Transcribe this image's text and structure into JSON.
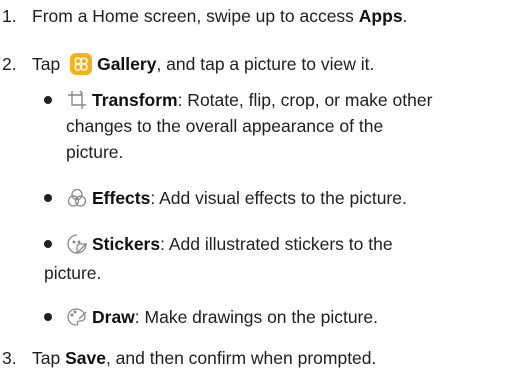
{
  "steps": [
    {
      "num": "1.",
      "pre": "From a Home screen, swipe up to access ",
      "bold": "Apps",
      "post": "."
    },
    {
      "num": "2.",
      "pre": "Tap ",
      "bold": "Gallery",
      "post": ", and tap a picture to view it.",
      "icon": "gallery-icon"
    },
    {
      "num": "3.",
      "pre": "Tap ",
      "bold": "Save",
      "post": ", and then confirm when prompted."
    }
  ],
  "bullets": [
    {
      "icon": "transform-icon",
      "bold": "Transform",
      "line1": ": Rotate, flip, crop, or make other",
      "line2": "changes to the overall appearance of the",
      "line3": "picture."
    },
    {
      "icon": "effects-icon",
      "bold": "Effects",
      "line1": ": Add visual effects to the picture."
    },
    {
      "icon": "stickers-icon",
      "bold": "Stickers",
      "line1": ": Add illustrated stickers to the",
      "line2": "picture."
    },
    {
      "icon": "draw-icon",
      "bold": "Draw",
      "line1": ": Make drawings on the picture."
    }
  ],
  "colors": {
    "text": "#202020",
    "gallery_icon": "#f5b31b",
    "icon_stroke": "#888888"
  }
}
